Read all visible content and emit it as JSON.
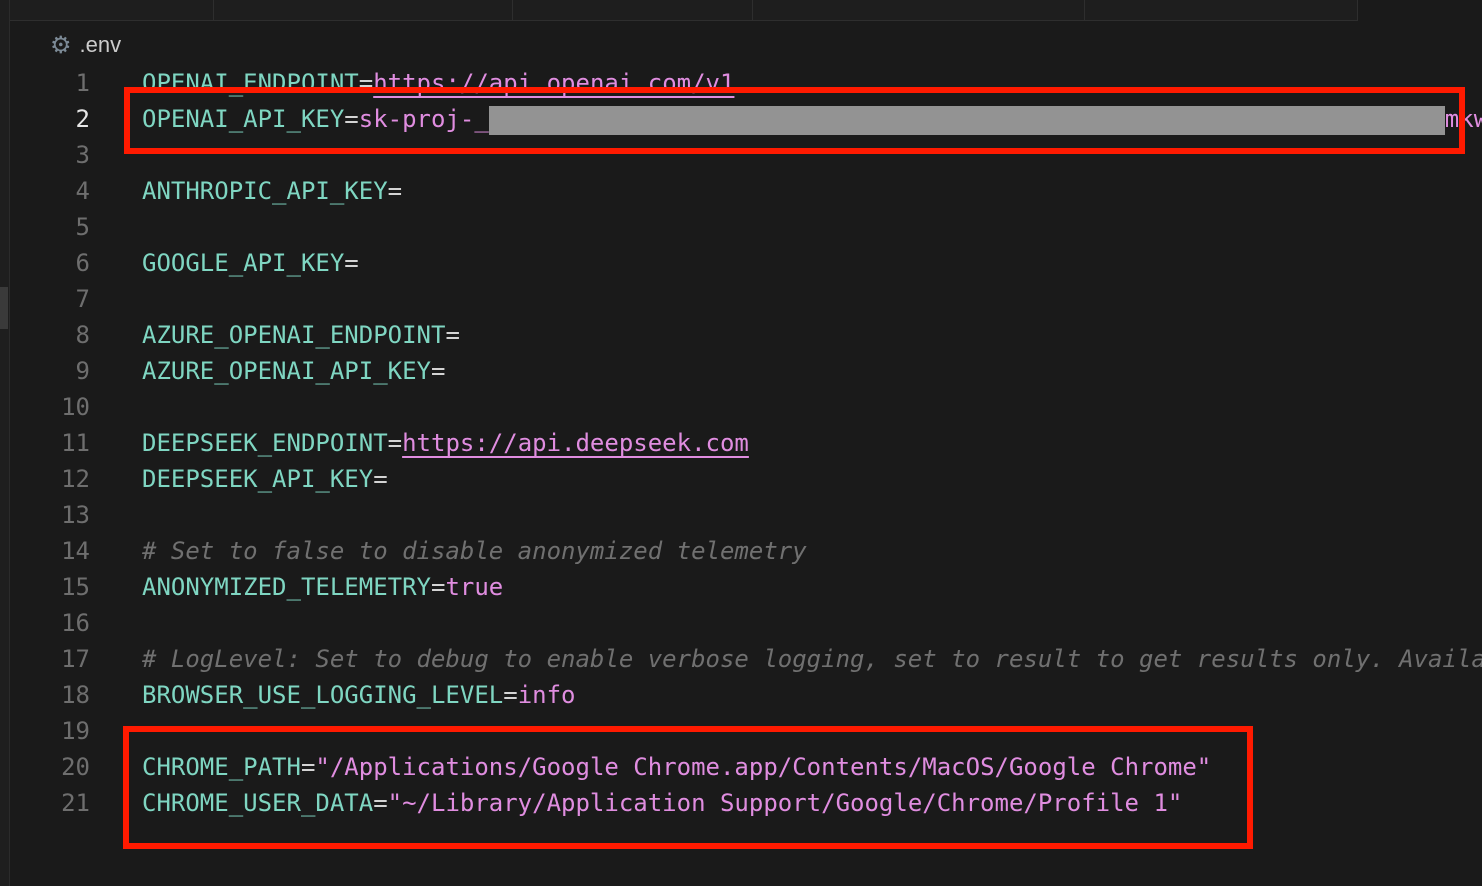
{
  "breadcrumb": {
    "icon": "gear-icon",
    "file": ".env"
  },
  "current_line": 2,
  "lines": [
    {
      "n": "1",
      "key": "OPENAI_ENDPOINT",
      "eq": "=",
      "url": "https://api.openai.com/v1"
    },
    {
      "n": "2",
      "key": "OPENAI_API_KEY",
      "eq": "=",
      "value": "sk-proj-_",
      "redacted": true,
      "tail": "mkw"
    },
    {
      "n": "3"
    },
    {
      "n": "4",
      "key": "ANTHROPIC_API_KEY",
      "eq": "="
    },
    {
      "n": "5"
    },
    {
      "n": "6",
      "key": "GOOGLE_API_KEY",
      "eq": "="
    },
    {
      "n": "7"
    },
    {
      "n": "8",
      "key": "AZURE_OPENAI_ENDPOINT",
      "eq": "="
    },
    {
      "n": "9",
      "key": "AZURE_OPENAI_API_KEY",
      "eq": "="
    },
    {
      "n": "10"
    },
    {
      "n": "11",
      "key": "DEEPSEEK_ENDPOINT",
      "eq": "=",
      "url": "https://api.deepseek.com"
    },
    {
      "n": "12",
      "key": "DEEPSEEK_API_KEY",
      "eq": "="
    },
    {
      "n": "13"
    },
    {
      "n": "14",
      "comment": "# Set to false to disable anonymized telemetry"
    },
    {
      "n": "15",
      "key": "ANONYMIZED_TELEMETRY",
      "eq": "=",
      "value": "true"
    },
    {
      "n": "16"
    },
    {
      "n": "17",
      "comment": "# LogLevel: Set to debug to enable verbose logging, set to result to get results only. Availa"
    },
    {
      "n": "18",
      "key": "BROWSER_USE_LOGGING_LEVEL",
      "eq": "=",
      "value": "info"
    },
    {
      "n": "19"
    },
    {
      "n": "20",
      "key": "CHROME_PATH",
      "eq": "=",
      "value": "\"/Applications/Google Chrome.app/Contents/MacOS/Google Chrome\""
    },
    {
      "n": "21",
      "key": "CHROME_USER_DATA",
      "eq": "=",
      "value": "\"~/Library/Application Support/Google/Chrome/Profile 1\""
    }
  ],
  "highlight_color": "#ff1a00"
}
